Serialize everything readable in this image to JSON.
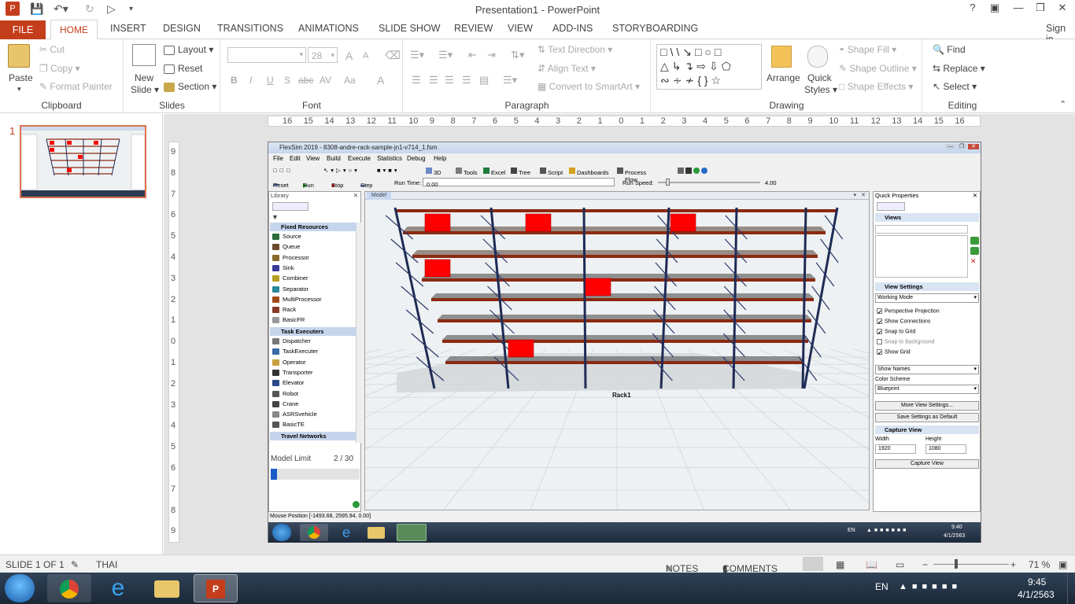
{
  "app": {
    "title": "Presentation1 - PowerPoint",
    "help": "?",
    "sign_in": "Sign in"
  },
  "tabs": [
    "FILE",
    "HOME",
    "INSERT",
    "DESIGN",
    "TRANSITIONS",
    "ANIMATIONS",
    "SLIDE SHOW",
    "REVIEW",
    "VIEW",
    "ADD-INS",
    "STORYBOARDING"
  ],
  "clipboard": {
    "paste": "Paste",
    "cut": "Cut",
    "copy": "Copy",
    "format_painter": "Format Painter",
    "label": "Clipboard"
  },
  "slides_group": {
    "new_slide_line1": "New",
    "new_slide_line2": "Slide",
    "layout": "Layout",
    "reset": "Reset",
    "section": "Section",
    "label": "Slides"
  },
  "font_group": {
    "size": "28",
    "label": "Font",
    "bold": "B",
    "italic": "I",
    "underline": "U",
    "shadow": "S",
    "strike": "abc",
    "spacing": "AV",
    "case": "Aa",
    "color": "A",
    "grow": "A",
    "shrink": "A"
  },
  "paragraph_group": {
    "text_direction": "Text Direction",
    "align_text": "Align Text",
    "convert_smartart": "Convert to SmartArt",
    "label": "Paragraph"
  },
  "drawing_group": {
    "arrange": "Arrange",
    "quick_styles_line1": "Quick",
    "quick_styles_line2": "Styles",
    "shape_fill": "Shape Fill",
    "shape_outline": "Shape Outline",
    "shape_effects": "Shape Effects",
    "label": "Drawing"
  },
  "editing_group": {
    "find": "Find",
    "replace": "Replace",
    "select": "Select",
    "label": "Editing"
  },
  "thumbnail": {
    "number": "1"
  },
  "hruler_ticks": [
    "16",
    "15",
    "14",
    "13",
    "12",
    "11",
    "10",
    "9",
    "8",
    "7",
    "6",
    "5",
    "4",
    "3",
    "2",
    "1",
    "0",
    "1",
    "2",
    "3",
    "4",
    "5",
    "6",
    "7",
    "8",
    "9",
    "10",
    "11",
    "12",
    "13",
    "14",
    "15",
    "16"
  ],
  "vruler_ticks": [
    "9",
    "8",
    "7",
    "6",
    "5",
    "4",
    "3",
    "2",
    "1",
    "0",
    "1",
    "2",
    "3",
    "4",
    "5",
    "6",
    "7",
    "8",
    "9"
  ],
  "flexsim": {
    "title": "FlexSim 2019 - 8308-andre-rack-sample-jn1-v714_1.fsm",
    "menu": [
      "File",
      "Edit",
      "View",
      "Build",
      "Execute",
      "Statistics",
      "Debug",
      "Help"
    ],
    "toolbar": [
      "3D",
      "Tools",
      "Excel",
      "Tree",
      "Script",
      "Dashboards",
      "Process Flow"
    ],
    "run": {
      "reset": "Reset",
      "run": "Run",
      "stop": "Stop",
      "step": "Step",
      "run_time_label": "Run Time:",
      "run_time": "0.00",
      "run_speed_label": "Run Speed:",
      "run_speed": "4.00"
    },
    "library": {
      "title": "Library",
      "fixed_header": "Fixed Resources",
      "fixed": [
        "Source",
        "Queue",
        "Processor",
        "Sink",
        "Combiner",
        "Separator",
        "MultiProcessor",
        "Rack",
        "BasicFR"
      ],
      "task_header": "Task Executers",
      "task": [
        "Dispatcher",
        "TaskExecuter",
        "Operator",
        "Transporter",
        "Elevator",
        "Robot",
        "Crane",
        "ASRSvehicle",
        "BasicTE"
      ],
      "travel_header": "Travel Networks",
      "model_limit_label": "Model Limit",
      "model_limit": "2 / 30",
      "model_limit_fraction": 0.067
    },
    "model_tab": "Model",
    "rack_label": "Rack1",
    "quick_props": {
      "title": "Quick Properties",
      "views": "Views",
      "view_settings": "View Settings",
      "working_mode": "Working Mode",
      "perspective": "Perspective Projection",
      "show_connections": "Show Connections",
      "snap_grid": "Snap to Grid",
      "snap_background": "Snap to Background",
      "show_grid": "Show Grid",
      "show_names": "Show Names",
      "color_scheme_label": "Color Scheme",
      "color_scheme": "Blueprint",
      "more_settings": "More View Settings...",
      "save_default": "Save Settings as Default",
      "capture_view": "Capture View",
      "width_label": "Width",
      "height_label": "Height",
      "width": "1920",
      "height": "1080",
      "capture_btn": "Capture View"
    },
    "status": "Mouse Position [-1493.68, 2595.94, 0.00]",
    "tray": {
      "lang": "EN",
      "time": "9:40",
      "date": "4/1/2563"
    }
  },
  "statusbar": {
    "slide": "SLIDE 1 OF 1",
    "lang": "THAI",
    "notes": "NOTES",
    "comments": "COMMENTS",
    "zoom": "71 %"
  },
  "taskbar": {
    "lang": "EN",
    "time": "9:45",
    "date": "4/1/2563"
  },
  "colors": {
    "accent": "#c43e1c",
    "rack_frame": "#1e2b55",
    "rack_beam": "#8b2a12",
    "box": "#ff0000"
  }
}
